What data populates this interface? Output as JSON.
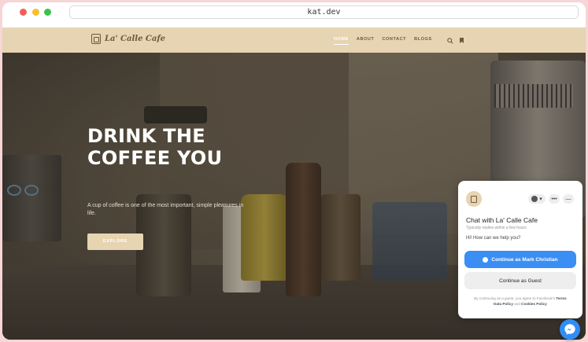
{
  "browser": {
    "url": "kat.dev"
  },
  "site": {
    "logo_text": "La' Calle Cafe",
    "nav": [
      {
        "label": "HOME",
        "active": true
      },
      {
        "label": "ABOUT"
      },
      {
        "label": "CONTACT"
      },
      {
        "label": "BLOGS"
      }
    ],
    "icons": [
      "search-icon",
      "bookmark-icon"
    ]
  },
  "hero": {
    "title": "DRINK THE COFFEE YOU",
    "subtitle": "A cup of coffee is one of the most important, simple pleasures in life.",
    "button_label": "EXPLORE"
  },
  "chat": {
    "title": "Chat with La' Calle Cafe",
    "replies_note": "Typically replies within a few hours",
    "greeting": "Hi! How can we help you?",
    "primary_button": "Continue as Mark Christian",
    "secondary_button": "Continue as Guest",
    "legal_prefix": "By continuing as a guest, you agree to Facebook's",
    "legal_terms": "Terms",
    "legal_data_policy": "Data Policy",
    "legal_and": "and",
    "legal_cookies": "Cookies Policy",
    "icons": [
      "profile-icon",
      "more-icon",
      "minimize-icon"
    ]
  },
  "colors": {
    "nav_bg": "#e6d4b2",
    "accent": "#e6d4b2",
    "messenger_blue": "#3b8ef3"
  }
}
